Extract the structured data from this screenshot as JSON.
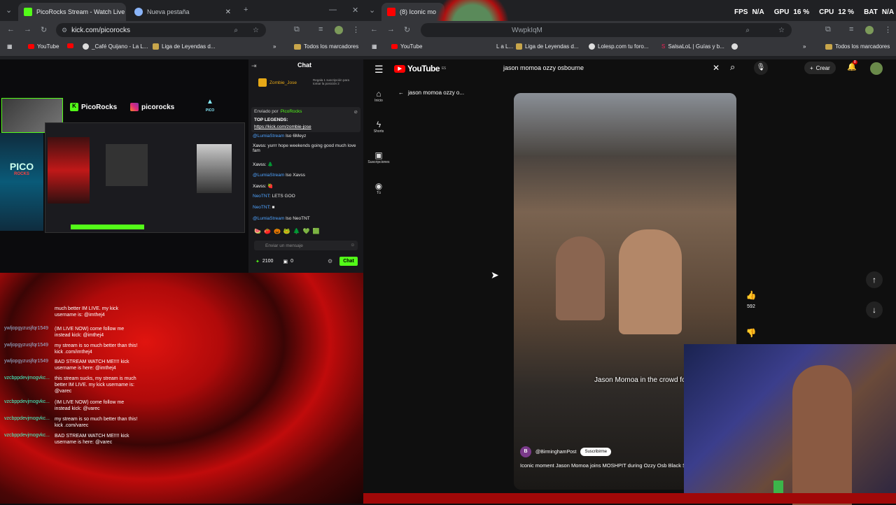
{
  "left_browser": {
    "tabs": [
      {
        "label": "PicoRocks Stream - Watch Live"
      },
      {
        "label": "Nueva pestaña"
      }
    ],
    "url": "kick.com/picorocks",
    "bookmarks": [
      "YouTube",
      "_Café Quijano - La L...",
      "Liga de Leyendas d...",
      "Todos los marcadores"
    ]
  },
  "stream": {
    "channel_name": "PicoRocks",
    "instagram": "picorocks",
    "logo_text": "PICO",
    "logo_sub": "ROCKS"
  },
  "chat": {
    "title": "Chat",
    "pinned_user": "Zombie_Jose",
    "pinned_side": "Regala 1 suscripción para tomar la posición 2",
    "sent_by_label": "Enviado por",
    "sent_by_user": "PicoRocks",
    "top_legends": "TOP LEGENDS:",
    "link": "https://kick.com/zombie-jose",
    "messages": [
      {
        "user": "@LumiaStream",
        "text": "lso 6Meyz"
      },
      {
        "user": "Xavss",
        "text": "yurrr hope weekends going good much love fam"
      },
      {
        "user": "Xavss",
        "text": ""
      },
      {
        "user": "@LumiaStream",
        "text": "lso Xavss"
      },
      {
        "user": "Xavss",
        "text": ""
      },
      {
        "user": "NeoTNT",
        "text": "LETS GOO"
      },
      {
        "user": "NeoTNT",
        "text": ""
      },
      {
        "user": "@LumiaStream",
        "text": "lso NeoTNT"
      }
    ],
    "input_placeholder": "Enviar un mensaje",
    "points": "2100",
    "count": "0",
    "send_label": "Chat"
  },
  "bottom_chat": [
    {
      "user": "",
      "text": "much better IM LIVE. my kick username is: @imthej4"
    },
    {
      "user": "ywljopgyzusjfqr1549",
      "text": "(IM LIVE NOW) come follow me instead kick: @imthej4"
    },
    {
      "user": "ywljopgyzusjfqr1549",
      "text": "my stream is so much better than this! kick .com/imthej4"
    },
    {
      "user": "ywljopgyzusjfqr1549",
      "text": "BAD STREAM WATCH ME!!!! kick username is here: @imthej4"
    },
    {
      "user": "vzcbppdevjmogvkc...",
      "text": "this stream sucks, my stream is much better IM LIVE. my kick username is: @varec"
    },
    {
      "user": "vzcbppdevjmogvkc...",
      "text": "(IM LIVE NOW) come follow me instead kick: @varec"
    },
    {
      "user": "vzcbppdevjmogvkc...",
      "text": "my stream is so much better than this! kick .com/varec"
    },
    {
      "user": "vzcbppdevjmogvkc...",
      "text": "BAD STREAM WATCH ME!!!! kick username is here: @varec"
    }
  ],
  "right_browser": {
    "tab_label": "(8) Iconic mo",
    "url_fragment": "WwpkIqM",
    "bookmarks": [
      "YouTube",
      "L a L...",
      "Liga de Leyendas d...",
      "Lolesp.com tu foro...",
      "SalsaLoL | Guías y b...",
      "Todos los marcadores"
    ]
  },
  "stats": {
    "fps_label": "FPS",
    "fps": "N/A",
    "gpu_label": "GPU",
    "gpu": "16 %",
    "cpu_label": "CPU",
    "cpu": "12 %",
    "bat_label": "BAT",
    "bat": "N/A"
  },
  "youtube": {
    "logo": "YouTube",
    "country": "ES",
    "search_value": "jason momoa ozzy osbourne",
    "create_label": "Crear",
    "notif_count": "8",
    "sidebar": [
      "Inicio",
      "Shorts",
      "Suscripciones",
      "Tú"
    ],
    "back_title": "jason momoa ozzy o...",
    "likes": "592",
    "caption": "Jason Momoa in the crowd for",
    "channel": "@BirminghamPost",
    "subscribe": "Suscribirme",
    "title": "Iconic moment Jason Momoa joins MOSHPIT during Ozzy Osb Black Sabbath show"
  }
}
